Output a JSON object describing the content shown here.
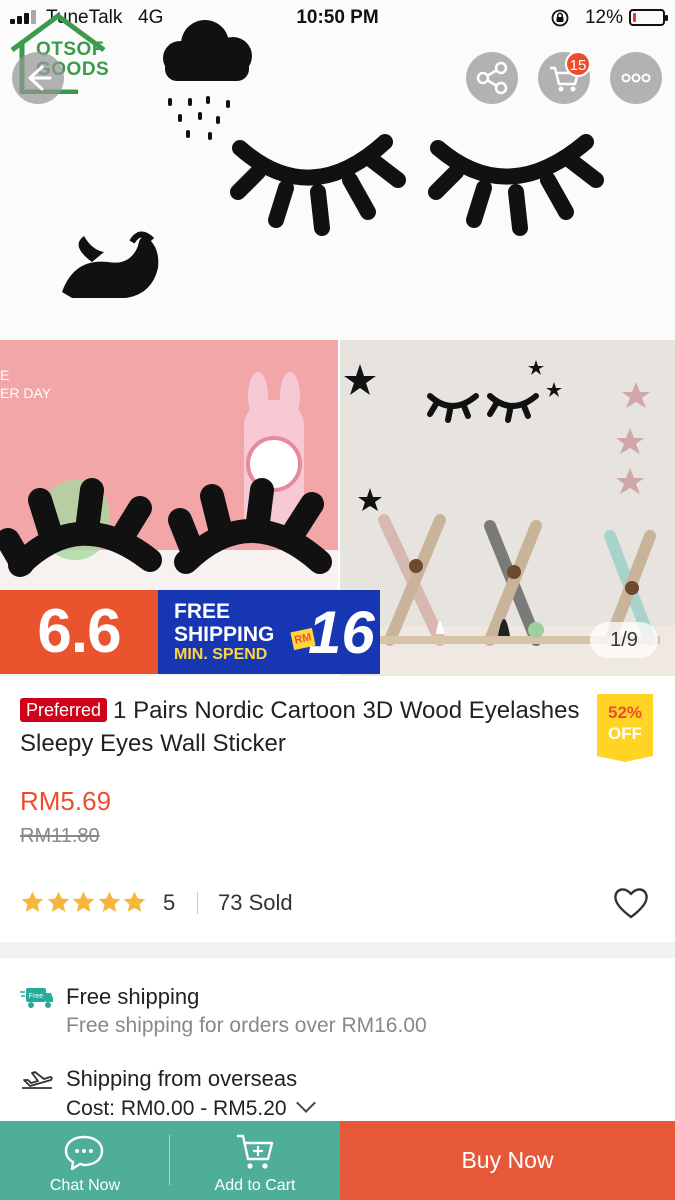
{
  "status_bar": {
    "carrier": "TuneTalk",
    "network": "4G",
    "time": "10:50 PM",
    "battery_percent": "12%",
    "battery_level": 0.12
  },
  "header": {
    "shop_logo_text": "OTSOF GOODS",
    "cart_count": "15",
    "buttons": [
      "back-icon",
      "share-icon",
      "cart-icon",
      "more-icon"
    ]
  },
  "gallery": {
    "promo_big": "6.6",
    "promo_line1": "FREE",
    "promo_line2": "SHIPPING",
    "promo_line3": "MIN. SPEND",
    "promo_currency": "RM",
    "promo_amount": "16",
    "counter": "1/9"
  },
  "product": {
    "badge": "Preferred",
    "title": "1 Pairs Nordic Cartoon 3D Wood Eyelashes Sleepy Eyes Wall Sticker",
    "discount_pct": "52%",
    "discount_word": "OFF",
    "price": "RM5.69",
    "original_price": "RM11.80",
    "rating": "5",
    "rating_value": 5,
    "sold": "73 Sold"
  },
  "shipping": {
    "free_icon_text": "Free",
    "free_title": "Free shipping",
    "free_sub": "Free shipping for orders over RM16.00",
    "from_prefix": "Shipping from ",
    "from_location": "overseas",
    "cost": "Cost: RM0.00 - RM5.20"
  },
  "bottom_bar": {
    "chat_label": "Chat Now",
    "cart_label": "Add to Cart",
    "buy_label": "Buy Now"
  },
  "colors": {
    "accent": "#ee4d2d",
    "bottom_teal": "#4eae9a",
    "buy_orange": "#e6583a",
    "promo_blue": "#1737b2",
    "discount_yellow": "#ffd424"
  }
}
